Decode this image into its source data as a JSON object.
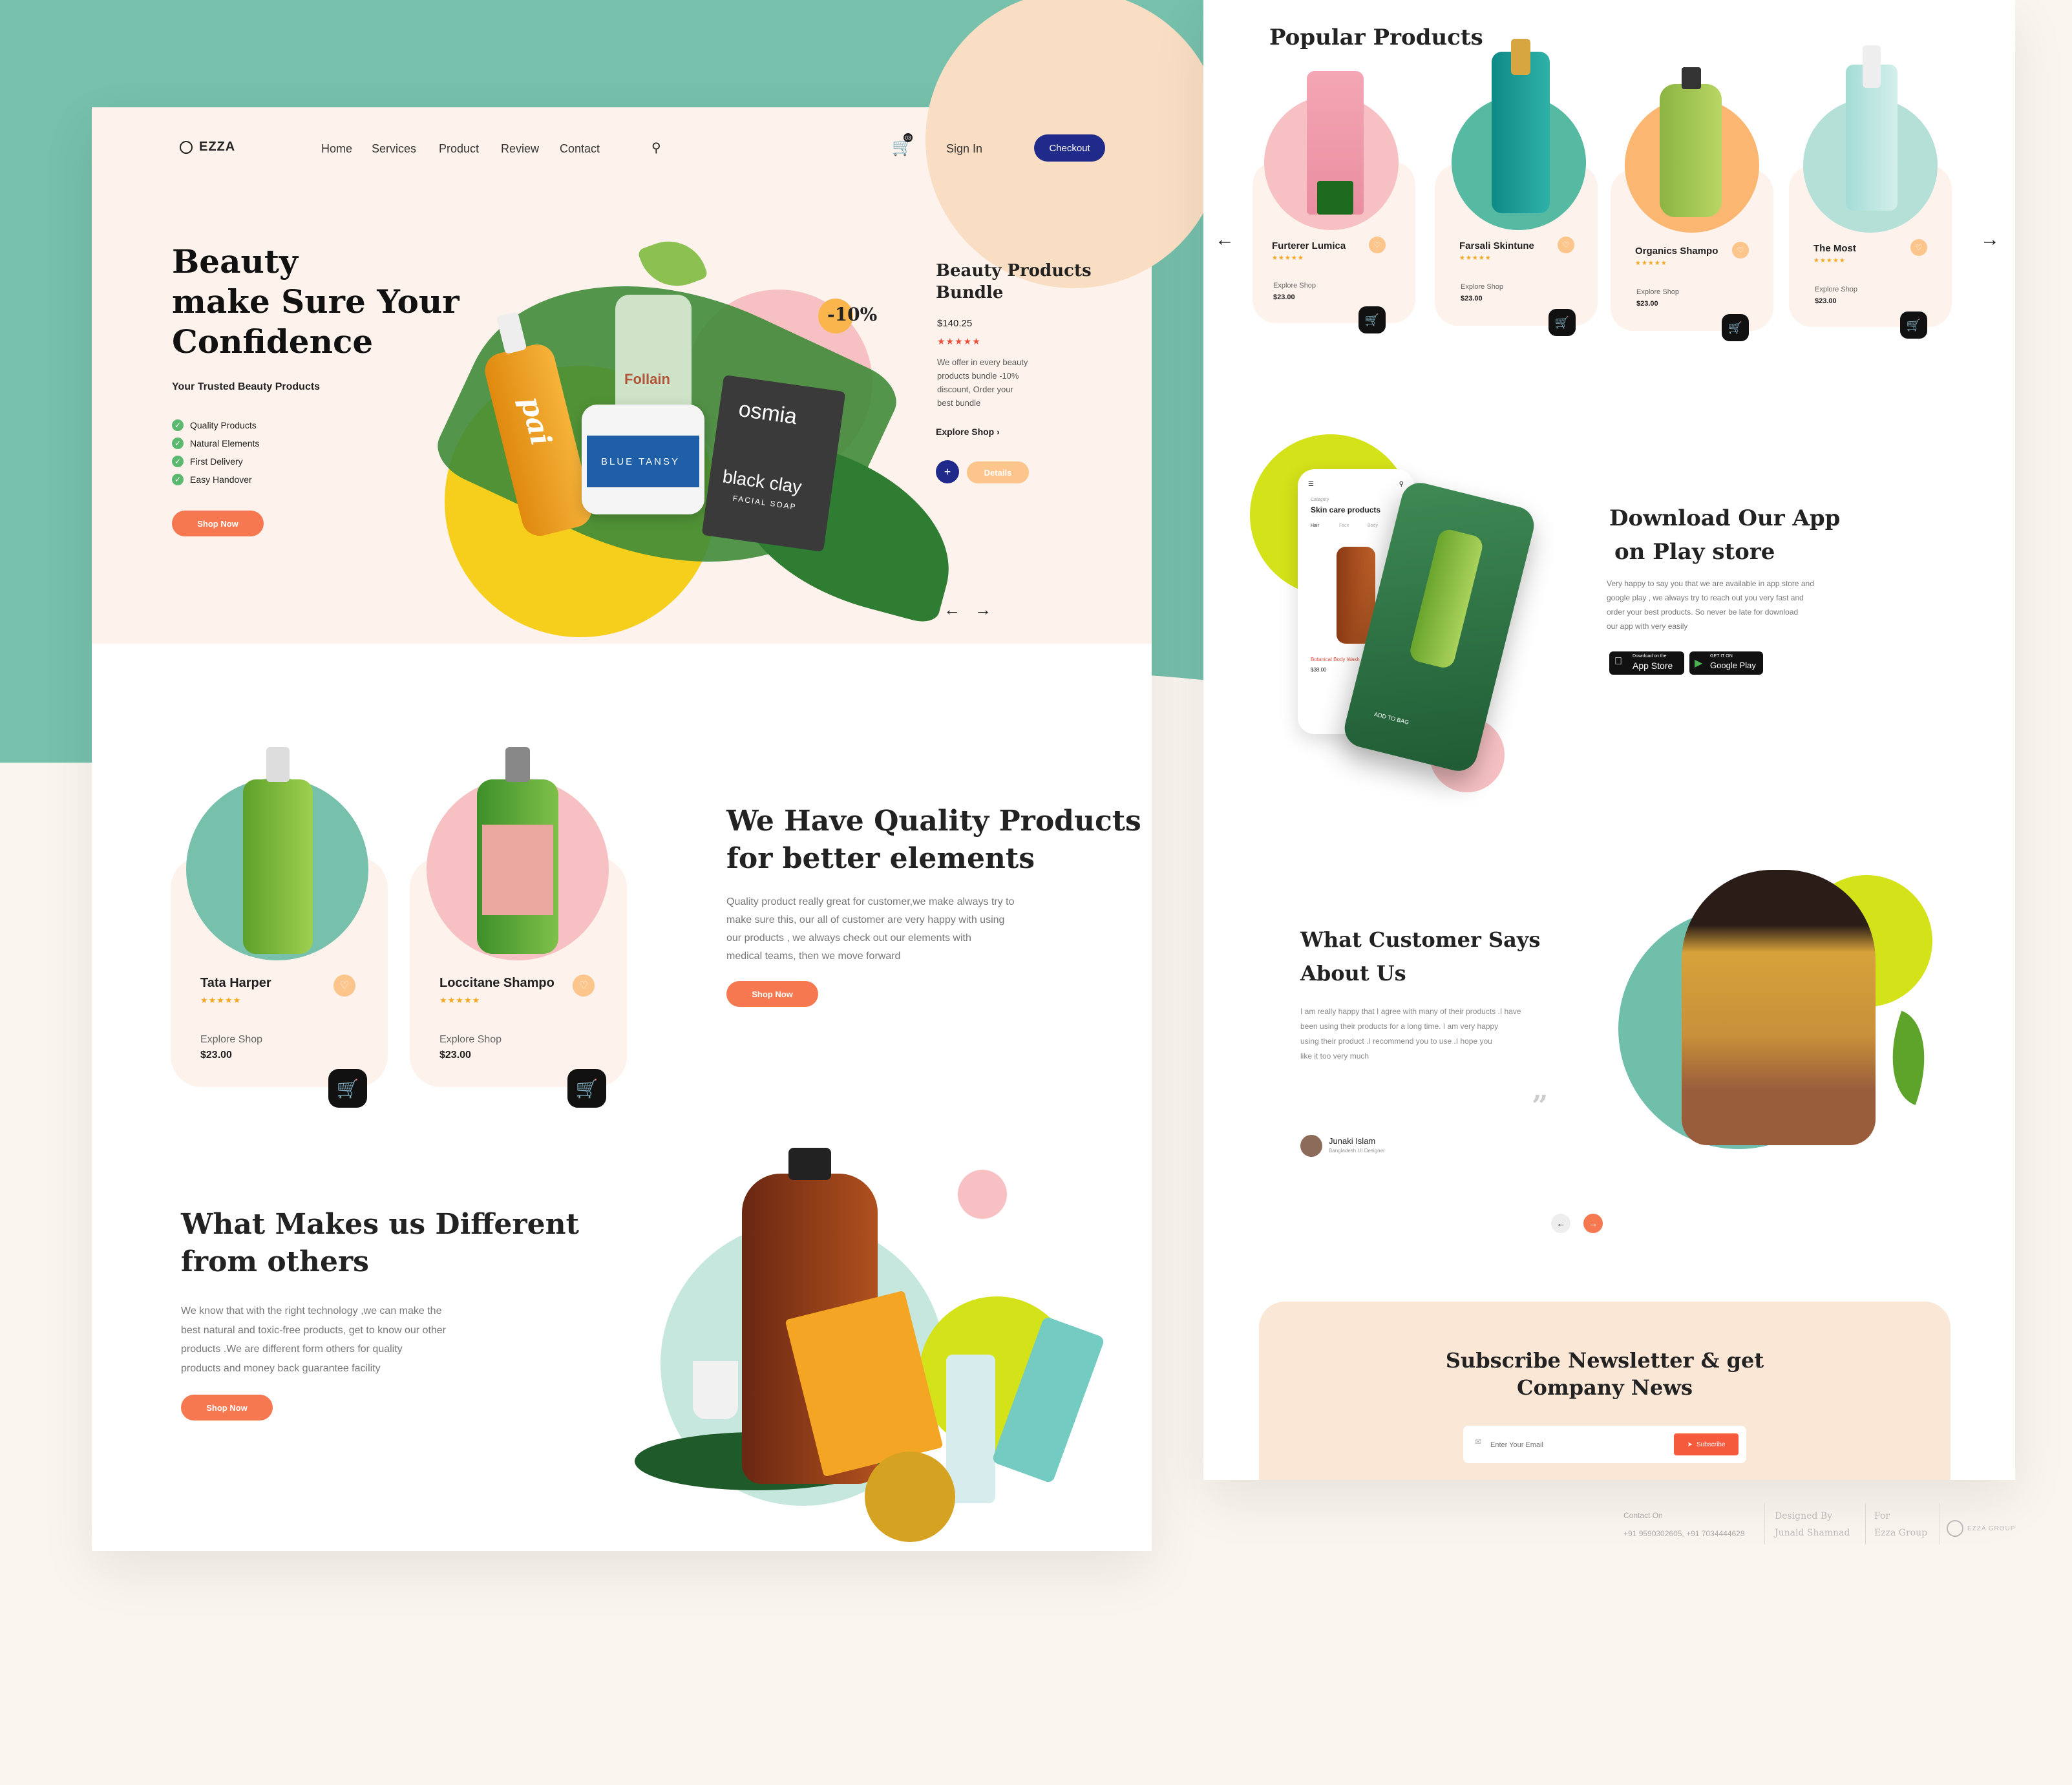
{
  "nav": {
    "logo": "EZZA",
    "links": [
      "Home",
      "Services",
      "Product",
      "Review",
      "Contact"
    ],
    "cart_count": "03",
    "sign_in": "Sign In",
    "checkout": "Checkout"
  },
  "hero": {
    "title_lines": [
      "Beauty",
      "make Sure Your",
      "Confidence"
    ],
    "subtitle": "Your Trusted Beauty Products",
    "features": [
      "Quality Products",
      "Natural Elements",
      "First Delivery",
      "Easy Handover"
    ],
    "cta": "Shop Now",
    "discount": "-10%",
    "bundle_title_lines": [
      "Beauty Products",
      "Bundle"
    ],
    "bundle_price": "$140.25",
    "bundle_desc_lines": [
      "We offer in every beauty",
      "products bundle -10%",
      "discount, Order your",
      "best bundle"
    ],
    "explore": "Explore Shop",
    "details": "Details",
    "product_labels": {
      "pai": "pai",
      "follain": "Follain",
      "blue_tansy": "BLUE TANSY",
      "osmia": "osmia",
      "black_clay": "black clay",
      "facial_soap": "FACIAL SOAP"
    }
  },
  "products_left": [
    {
      "name": "Tata Harper",
      "explore": "Explore Shop",
      "price": "$23.00"
    },
    {
      "name": "Loccitane Shampo",
      "explore": "Explore Shop",
      "price": "$23.00"
    }
  ],
  "quality": {
    "title_lines": [
      "We Have Quality Products",
      "for better elements"
    ],
    "body_lines": [
      "Quality product really great for customer,we make always try to",
      "make sure this, our all of customer are very happy with using",
      "our products , we always check out our elements with",
      "medical teams, then we move forward"
    ],
    "cta": "Shop Now"
  },
  "different": {
    "title_lines": [
      "What Makes us Different",
      "from others"
    ],
    "body_lines": [
      "We know that with the right technology ,we can make the",
      "best natural and toxic-free products, get to know our other",
      "products .We are different form others for quality",
      "products and money back guarantee facility"
    ],
    "cta": "Shop Now"
  },
  "popular": {
    "title": "Popular Products",
    "items": [
      {
        "name": "Furterer Lumica",
        "explore": "Explore Shop",
        "price": "$23.00"
      },
      {
        "name": "Farsali Skintune",
        "explore": "Explore Shop",
        "price": "$23.00"
      },
      {
        "name": "Organics Shampo",
        "explore": "Explore Shop",
        "price": "$23.00"
      },
      {
        "name": "The Most",
        "explore": "Explore Shop",
        "price": "$23.00"
      }
    ]
  },
  "app": {
    "title_lines": [
      "Download Our App",
      "on Play store"
    ],
    "body_lines": [
      "Very happy to say you that we are available in app store and",
      "google play , we always try to reach out you very fast  and",
      "order your best products. So  never be late for download",
      "our app with very easily"
    ],
    "app_store": "App Store",
    "app_store_small": "Download on the",
    "google_play": "Google Play",
    "google_play_small": "GET IT ON",
    "phone_category": "Category",
    "phone_title": "Skin care products",
    "phone_tabs": [
      "Hair",
      "Face",
      "Body"
    ],
    "phone_product": "Botanical Body Wash",
    "phone_price": "$38.00",
    "phone_add": "ADD TO BAG"
  },
  "testimonial": {
    "title_lines": [
      "What Customer Says",
      "About Us"
    ],
    "body_lines": [
      "I am really happy that I agree with many of their products .I have",
      "been using their products for a long time. I am very happy",
      "using their product .I recommend you to use .I hope you",
      "like it too very much"
    ],
    "author": "Junaki Islam",
    "role": "Bangladesh UI Designer"
  },
  "newsletter": {
    "title_lines": [
      "Subscribe Newsletter & get",
      "Company News"
    ],
    "placeholder": "Enter Your Email",
    "button": "Subscribe"
  },
  "footer": {
    "contact_label": "Contact On",
    "contact_value": "+91 9590302605, +91 7034444628",
    "designed_label": "Designed By",
    "designed_value": "Junaid Shamnad",
    "for_label": "For",
    "for_value": "Ezza Group",
    "brand": "EZZA GROUP"
  },
  "colors": {
    "teal": "#76c0ac",
    "orange": "#f57851",
    "navy": "#1f2a8a",
    "pink": "#f7c1c4",
    "yellow": "#f6cf1c",
    "lime": "#d4e21a",
    "cream": "#fdf3ec"
  }
}
